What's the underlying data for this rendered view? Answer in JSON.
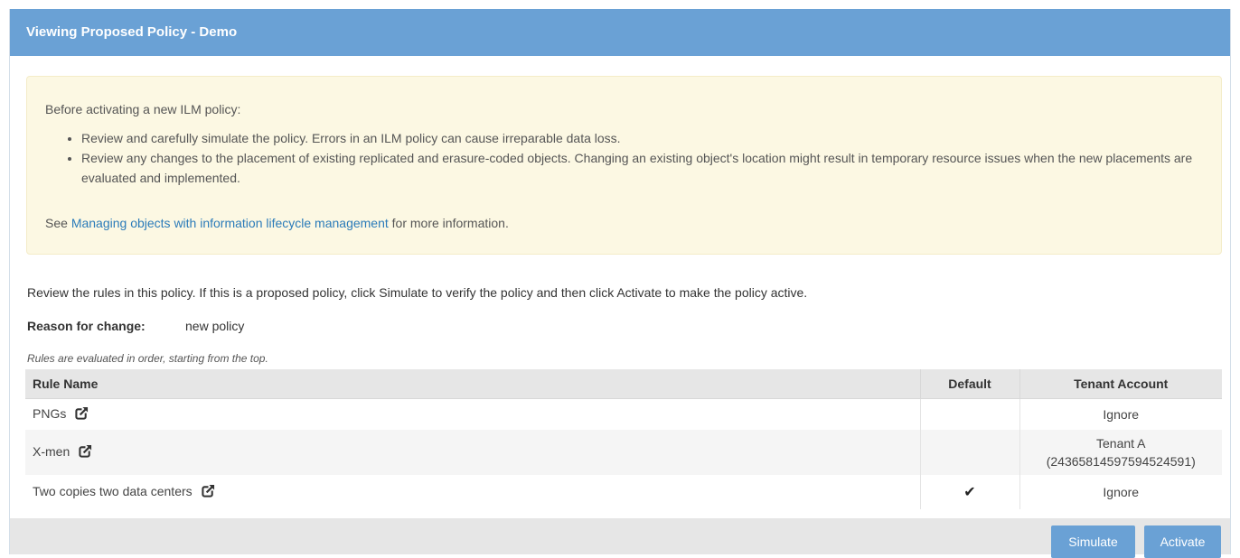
{
  "dialog": {
    "title": "Viewing Proposed Policy - Demo"
  },
  "alert": {
    "intro": "Before activating a new ILM policy:",
    "bullets": [
      "Review and carefully simulate the policy. Errors in an ILM policy can cause irreparable data loss.",
      "Review any changes to the placement of existing replicated and erasure-coded objects. Changing an existing object's location might result in temporary resource issues when the new placements are evaluated and implemented."
    ],
    "see_prefix": "See ",
    "link_text": "Managing objects with information lifecycle management",
    "see_suffix": " for more information."
  },
  "description": "Review the rules in this policy. If this is a proposed policy, click Simulate to verify the policy and then click Activate to make the policy active.",
  "reason": {
    "label": "Reason for change:",
    "value": "new policy"
  },
  "order_note": "Rules are evaluated in order, starting from the top.",
  "table": {
    "headers": {
      "rule_name": "Rule Name",
      "default": "Default",
      "tenant_account": "Tenant Account"
    },
    "rows": [
      {
        "rule_name": "PNGs",
        "default": "",
        "tenant_line1": "Ignore",
        "tenant_line2": ""
      },
      {
        "rule_name": "X-men",
        "default": "",
        "tenant_line1": "Tenant A",
        "tenant_line2": "(24365814597594524591)"
      },
      {
        "rule_name": "Two copies two data centers",
        "default": "✔",
        "tenant_line1": "Ignore",
        "tenant_line2": ""
      }
    ]
  },
  "buttons": {
    "simulate": "Simulate",
    "activate": "Activate"
  },
  "icons": {
    "external_link": "external-link-icon",
    "default_check": "check-icon"
  },
  "colors": {
    "header_bg": "#6aa1d5",
    "alert_bg": "#fcf8e3",
    "link": "#2b7bb9",
    "button_bg": "#6aa1d5"
  }
}
